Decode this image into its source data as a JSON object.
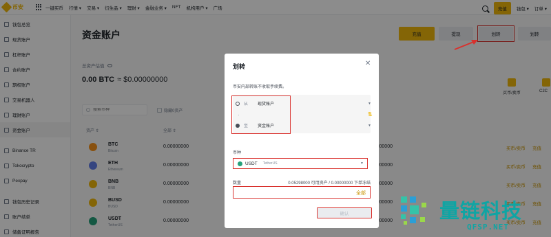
{
  "header": {
    "logo_text": "币安",
    "nav_items": [
      "一键买币",
      "行情 ▾",
      "交易 ▾",
      "衍生品 ▾",
      "理财 ▾",
      "金融业务 ▾",
      "NFT",
      "机构用户 ▾",
      "广场"
    ],
    "deposit_label": "充值",
    "wallet_label": "钱包 ▾",
    "orders_label": "订单 ▾"
  },
  "sidebar": {
    "items": [
      {
        "label": "钱包总览"
      },
      {
        "label": "现货账户"
      },
      {
        "label": "杠杆账户"
      },
      {
        "label": "合约账户"
      },
      {
        "label": "期权账户"
      },
      {
        "label": "交易机器人"
      },
      {
        "label": "理财账户"
      },
      {
        "label": "资金账户"
      },
      {
        "label": "Binance TR"
      },
      {
        "label": "Tokocrypto"
      },
      {
        "label": "Pexpay"
      },
      {
        "label": "钱包历史记录"
      },
      {
        "label": "账户结单"
      },
      {
        "label": "储备证明报告"
      }
    ]
  },
  "main": {
    "title": "资金账户",
    "buttons": {
      "deposit": "充值",
      "withdraw": "提现",
      "transfer": "划转",
      "convert": "划转"
    },
    "estimate_label": "总资产估值",
    "estimate_btc": "0.00 BTC",
    "estimate_usd": "≈ $0.00000000",
    "quick_actions": [
      "买币/卖币",
      "C2C"
    ],
    "search_placeholder": "搜索币种",
    "hide_small_label": "隐藏0资产",
    "table": {
      "headers": [
        "资产 ⇕",
        "全部 ⇕"
      ],
      "rows": [
        {
          "symbol": "BTC",
          "name": "Bitcoin",
          "amount": "0.00000000",
          "color": "#f7931a",
          "actions": [
            "买币/卖币",
            "充值"
          ]
        },
        {
          "symbol": "ETH",
          "name": "Ethereum",
          "amount": "0.00000000",
          "color": "#627eea",
          "actions": [
            "买币/卖币",
            "充值"
          ]
        },
        {
          "symbol": "BNB",
          "name": "BNB",
          "amount": "0.00000000",
          "color": "#f0b90b",
          "actions": [
            "买币/卖币",
            "充值"
          ]
        },
        {
          "symbol": "BUSD",
          "name": "BUSD",
          "amount": "0.00000000",
          "color": "#f0b90b",
          "actions": [
            "买币/卖币",
            "充值"
          ]
        },
        {
          "symbol": "USDT",
          "name": "TetherUS",
          "amount": "0.00000000",
          "color": "#26a17b",
          "actions": [
            "买币/卖币",
            "充值"
          ]
        }
      ]
    }
  },
  "modal": {
    "title": "划转",
    "notice": "币安内部转账不收取手续费。",
    "from_label": "从",
    "from_account": "现货账户",
    "to_label": "至",
    "to_account": "资金账户",
    "coin_label": "币种",
    "coin_symbol": "USDT",
    "coin_name": "TetherUS",
    "amount_label": "数量",
    "available_text": "0.05298000 可用资产 / 0.00000000 下单冻结",
    "max_label": "全部",
    "confirm_label": "确认"
  },
  "watermark": {
    "text": "量链科技",
    "domain": "QFSP.NET"
  }
}
